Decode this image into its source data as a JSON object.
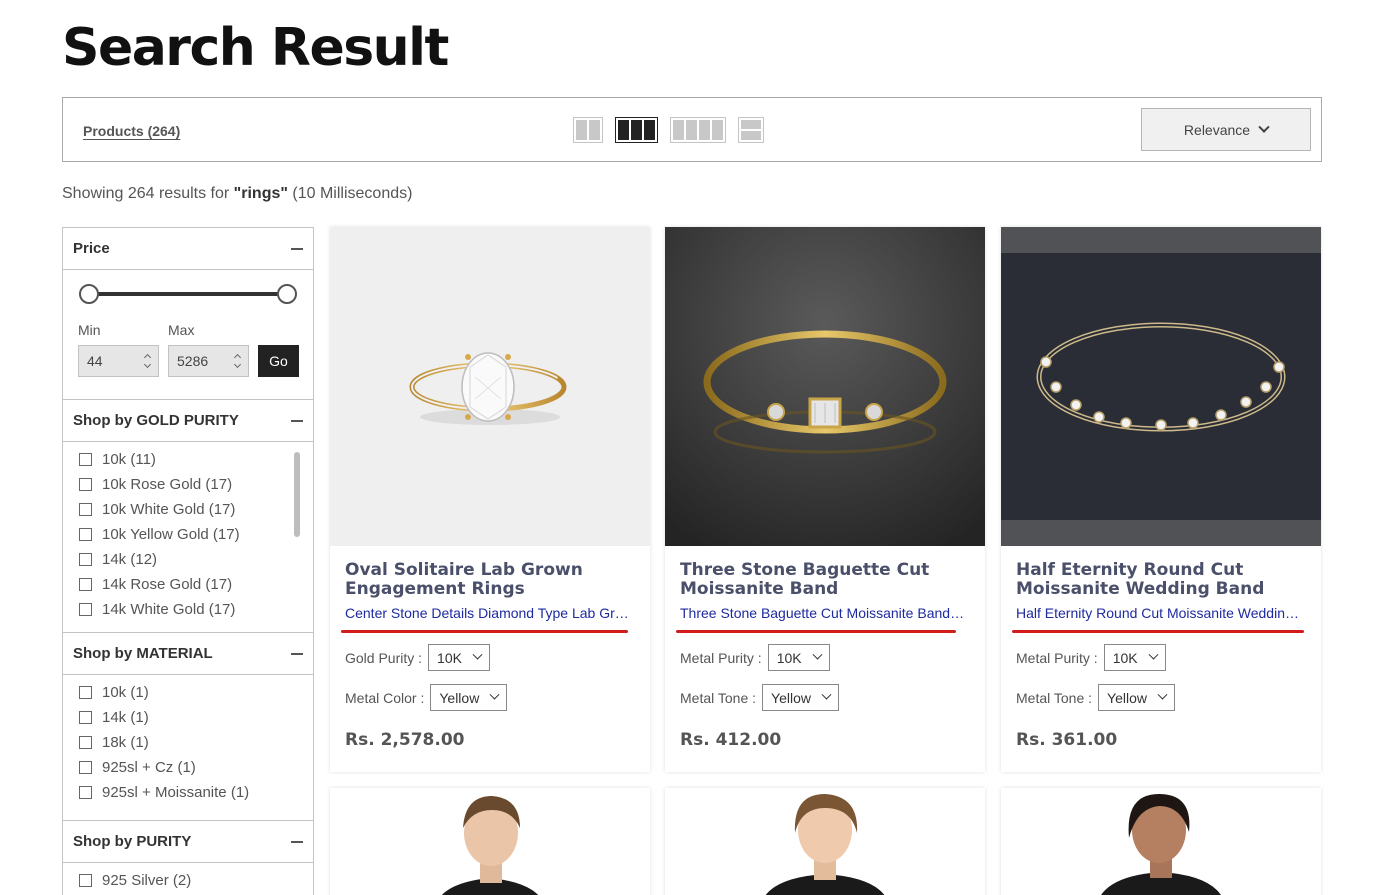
{
  "page": {
    "title": "Search Result"
  },
  "toolbar": {
    "products_label": "Products (264)",
    "sort_label": "Relevance",
    "views": [
      "2-column-grid",
      "3-column-grid",
      "4-column-grid",
      "list-view"
    ]
  },
  "summary": {
    "prefix": "Showing 264 results for ",
    "query": "\"rings\"",
    "suffix": " (10 Milliseconds)"
  },
  "sidebar": {
    "price": {
      "title": "Price",
      "min_label": "Min",
      "max_label": "Max",
      "min_value": "44",
      "max_value": "5286",
      "go_label": "Go"
    },
    "gold_purity": {
      "title": "Shop by GOLD PURITY",
      "items": [
        "10k (11)",
        "10k Rose Gold (17)",
        "10k White Gold (17)",
        "10k Yellow Gold (17)",
        "14k (12)",
        "14k Rose Gold (17)",
        "14k White Gold (17)"
      ]
    },
    "material": {
      "title": "Shop by MATERIAL",
      "items": [
        "10k (1)",
        "14k (1)",
        "18k (1)",
        "925sl + Cz (1)",
        "925sl + Moissanite (1)"
      ]
    },
    "purity": {
      "title": "Shop by PURITY",
      "items": [
        "925 Silver (2)"
      ]
    }
  },
  "products": [
    {
      "title": "Oval Solitaire Lab Grown Engagement Rings",
      "subtitle": "Center Stone Details Diamond Type Lab Grown Diamond",
      "opt1_label": "Gold Purity :",
      "opt1_value": "10K",
      "opt2_label": "Metal Color :",
      "opt2_value": "Yellow",
      "price": "Rs. 2,578.00"
    },
    {
      "title": "Three Stone Baguette Cut Moissanite Band",
      "subtitle": "Three Stone Baguette Cut Moissanite Band, Stackable Ring",
      "opt1_label": "Metal Purity :",
      "opt1_value": "10K",
      "opt2_label": "Metal Tone :",
      "opt2_value": "Yellow",
      "price": "Rs. 412.00"
    },
    {
      "title": "Half Eternity Round Cut Moissanite Wedding Band",
      "subtitle": "Half Eternity Round Cut Moissanite Wedding Band Ring",
      "opt1_label": "Metal Purity :",
      "opt1_value": "10K",
      "opt2_label": "Metal Tone :",
      "opt2_value": "Yellow",
      "price": "Rs. 361.00"
    }
  ],
  "colors": {
    "title_color": "#4a4f6a",
    "link_color": "#1e2aa0",
    "underline_red": "#d21b1b"
  }
}
